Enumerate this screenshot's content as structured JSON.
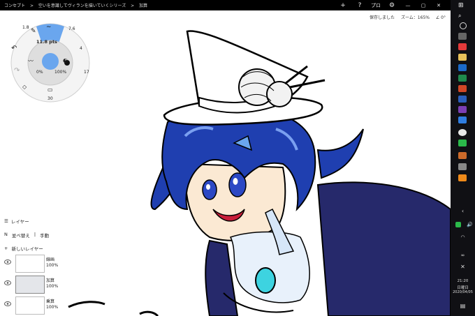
{
  "titlebar": {
    "crumbs": [
      "コンセプト",
      ">",
      "空いを意識してヴィランを描いていくシリーズ",
      ">",
      "加算"
    ],
    "buttons": {
      "add": "+",
      "help": "?",
      "pro": "プロ",
      "settings": "⚙",
      "minimize": "—",
      "restore": "▢",
      "close": "✕"
    }
  },
  "status": {
    "saved": "保存しました",
    "zoom": "ズーム：165%",
    "rotation": "∠ 0°"
  },
  "brush_wheel": {
    "size_top": "11.8",
    "size_label": "11.8 pts",
    "opacity_min": "0%",
    "opacity_max": "100%",
    "left_value": "1.8",
    "right_value": "7.6",
    "right_upper": "4",
    "right_lower": "17",
    "bottom_value": "30",
    "colors": {
      "accent": "#6aa6ee",
      "ring": "#f4f4f4",
      "center": "#6aa6ee",
      "highlight": "#a8ccf6"
    }
  },
  "layers": {
    "title": "レイヤー",
    "sort": [
      "並べ替え",
      "|",
      "手動"
    ],
    "new_layer": "新しいレイヤー",
    "items": [
      {
        "name": "線画",
        "opacity": "100%",
        "active": false
      },
      {
        "name": "加算",
        "opacity": "100%",
        "active": true
      },
      {
        "name": "乗算",
        "opacity": "100%",
        "active": false
      }
    ]
  },
  "taskbar": {
    "time": "21:20",
    "day": "日曜日",
    "date": "2020/04/05",
    "icons": [
      "windows-icon",
      "search-icon",
      "cortana-icon",
      "taskview-icon",
      "opera-icon",
      "explorer-icon",
      "outlook-icon",
      "excel-icon",
      "powerpoint-icon",
      "word-icon",
      "onenote-icon",
      "todo-icon",
      "chrome-icon",
      "line-icon",
      "concepts-icon",
      "app-icon",
      "vlc-icon"
    ]
  }
}
